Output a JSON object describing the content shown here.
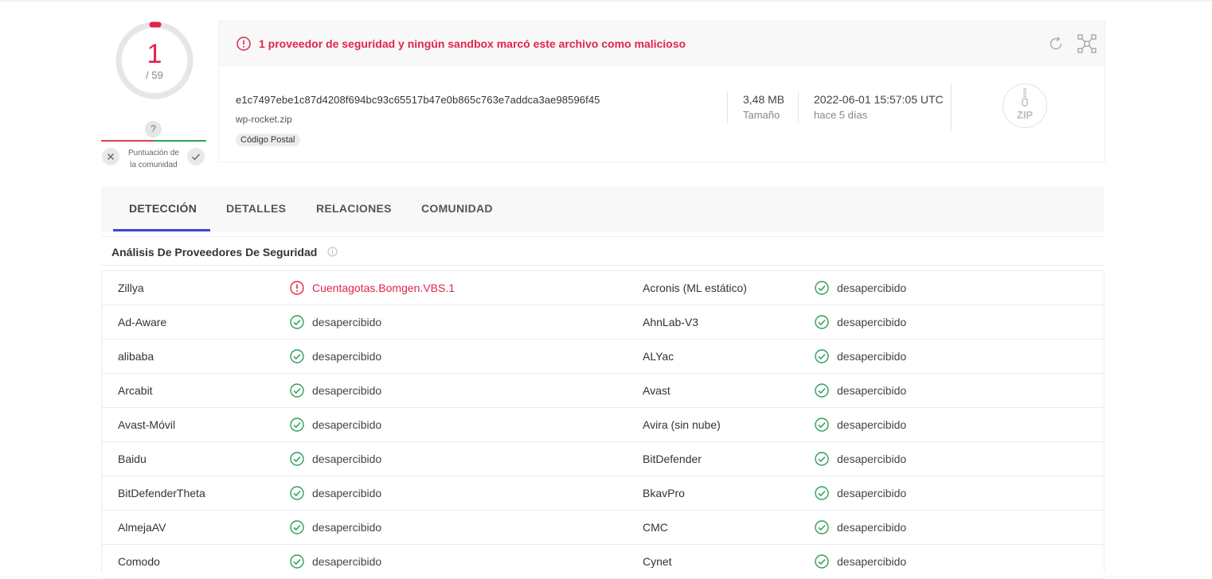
{
  "score": {
    "detections": "1",
    "total": "/ 59"
  },
  "community": {
    "question": "?",
    "label_line1": "Puntuación de",
    "label_line2": "la comunidad"
  },
  "alert": {
    "text": "1 proveedor de seguridad y ningún sandbox marcó este archivo como malicioso"
  },
  "file": {
    "hash": "e1c7497ebe1c87d4208f694bc93c65517b47e0b865c763e7addca3ae98596f45",
    "name": "wp-rocket.zip",
    "tag": "Código Postal",
    "size_value": "3,48 MB",
    "size_label": "Tamaño",
    "date_value": "2022-06-01 15:57:05 UTC",
    "date_label": "hace 5 días",
    "type_icon_label": "ZIP"
  },
  "tabs": [
    {
      "label": "DETECCIÓN"
    },
    {
      "label": "DETALLES"
    },
    {
      "label": "RELACIONES"
    },
    {
      "label": "COMUNIDAD"
    }
  ],
  "section": {
    "title": "Análisis De Proveedores De Seguridad"
  },
  "results": [
    {
      "left_engine": "Zillya",
      "left_result": "Cuentagotas.Bomgen.VBS.1",
      "left_status": "malicious",
      "right_engine": "Acronis (ML estático)",
      "right_result": "desapercibido",
      "right_status": "clean"
    },
    {
      "left_engine": "Ad-Aware",
      "left_result": "desapercibido",
      "left_status": "clean",
      "right_engine": "AhnLab-V3",
      "right_result": "desapercibido",
      "right_status": "clean"
    },
    {
      "left_engine": "alibaba",
      "left_result": "desapercibido",
      "left_status": "clean",
      "right_engine": "ALYac",
      "right_result": "desapercibido",
      "right_status": "clean"
    },
    {
      "left_engine": "Arcabit",
      "left_result": "desapercibido",
      "left_status": "clean",
      "right_engine": "Avast",
      "right_result": "desapercibido",
      "right_status": "clean"
    },
    {
      "left_engine": "Avast-Móvil",
      "left_result": "desapercibido",
      "left_status": "clean",
      "right_engine": "Avira (sin nube)",
      "right_result": "desapercibido",
      "right_status": "clean"
    },
    {
      "left_engine": "Baidu",
      "left_result": "desapercibido",
      "left_status": "clean",
      "right_engine": "BitDefender",
      "right_result": "desapercibido",
      "right_status": "clean"
    },
    {
      "left_engine": "BitDefenderTheta",
      "left_result": "desapercibido",
      "left_status": "clean",
      "right_engine": "BkavPro",
      "right_result": "desapercibido",
      "right_status": "clean"
    },
    {
      "left_engine": "AlmejaAV",
      "left_result": "desapercibido",
      "left_status": "clean",
      "right_engine": "CMC",
      "right_result": "desapercibido",
      "right_status": "clean"
    },
    {
      "left_engine": "Comodo",
      "left_result": "desapercibido",
      "left_status": "clean",
      "right_engine": "Cynet",
      "right_result": "desapercibido",
      "right_status": "clean"
    }
  ],
  "colors": {
    "malicious": "#e0254a",
    "clean": "#2f9e5b",
    "tab_accent": "#3b46d6"
  },
  "icons": {
    "malicious": "alert-circle-icon",
    "clean": "check-circle-icon"
  }
}
